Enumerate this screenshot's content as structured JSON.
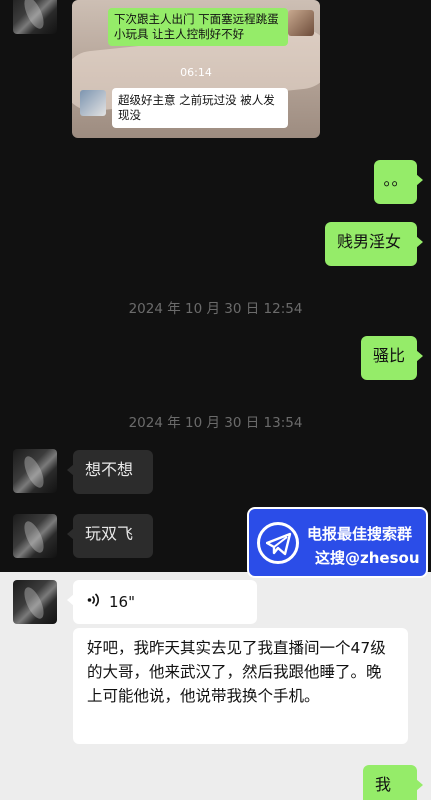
{
  "media_card": {
    "overlay_top": "下次跟主人出门 下面塞远程跳蛋小玩具 让主人控制好不好",
    "timestamp": "06:14",
    "overlay_bottom": "超级好主意 之前玩过没 被人发现没"
  },
  "messages": [
    {
      "id": "m1",
      "side": "right",
      "text": "。。"
    },
    {
      "id": "m2",
      "side": "right",
      "text": "贱男淫女"
    },
    {
      "id": "t1",
      "type": "time",
      "text": "2024 年 10 月 30 日 12:54"
    },
    {
      "id": "m3",
      "side": "right",
      "text": "骚比"
    },
    {
      "id": "t2",
      "type": "time",
      "text": "2024 年 10 月 30 日 13:54"
    },
    {
      "id": "m4",
      "side": "left",
      "text": "想不想"
    },
    {
      "id": "m5",
      "side": "left",
      "text": "玩双飞"
    },
    {
      "id": "m6",
      "side": "left",
      "type": "voice",
      "text": "16\""
    },
    {
      "id": "m7",
      "side": "left",
      "text": "好吧，我昨天其实去见了我直播间一个47级的大哥，他来武汉了，然后我跟他睡了。晚上可能他说，他说带我换个手机。"
    },
    {
      "id": "m8",
      "side": "right",
      "text": "我操"
    }
  ],
  "watermark": {
    "line1": "电报最佳搜索群",
    "line2": "这搜@zhesou",
    "icon": "telegram-plane-icon"
  },
  "colors": {
    "green_bubble": "#95ec69",
    "dark_bubble": "#2c2c2c",
    "dark_bg": "#111111",
    "light_bg": "#ededed",
    "watermark_bg": "#2b4de8"
  }
}
